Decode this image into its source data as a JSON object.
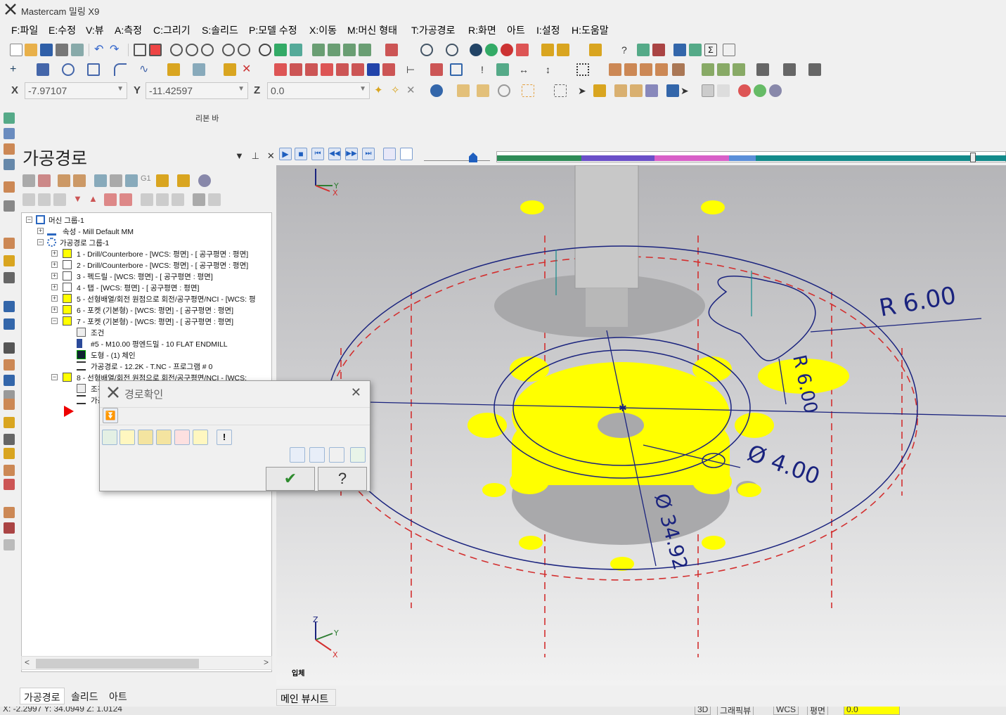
{
  "window": {
    "title": "Mastercam 밀링 X9"
  },
  "menu": [
    "F:파일",
    "E:수정",
    "V:뷰",
    "A:측정",
    "C:그리기",
    "S:솔리드",
    "P:모델 수정",
    "X:이동",
    "M:머신 형태",
    "T:가공경로",
    "R:화면",
    "아트",
    "I:설정",
    "H:도움말"
  ],
  "coords": {
    "x_label": "X",
    "x_value": "-7.97107",
    "y_label": "Y",
    "y_value": "-11.42597",
    "z_label": "Z",
    "z_value": "0.0"
  },
  "ribbon_label": "리본 바",
  "panel": {
    "title": "가공경로",
    "tree": [
      "머신 그룹-1",
      "속성 - Mill Default MM",
      "가공경로 그룹-1",
      "1 - Drill/Counterbore - [WCS: 평면] - [ 공구평면 : 평면]",
      "2 - Drill/Counterbore - [WCS: 평면] - [ 공구평면 : 평면]",
      "3 - 펙드릴 - [WCS: 평면] - [ 공구평면 : 평면]",
      "4 - 탭 - [WCS: 평면] - [ 공구평면 : 평면]",
      "5 - 선형배열/회전 원점으로 회전/공구평면/NCI - [WCS: 평",
      "6 - 포켓 (기본형) - [WCS: 평면] - [ 공구평면 : 평면]",
      "7 - 포켓 (기본형) - [WCS: 평면] - [ 공구평면 : 평면]",
      "조건",
      "#5 - M10.00 평엔드밀 - 10 FLAT ENDMILL",
      "도형 - (1) 체인",
      "가공경로 - 12.2K - T.NC - 프로그램 # 0",
      "8 - 선형배열/회전 원점으로 회전/공구평면/NCI - [WCS:",
      "조건",
      "가공경로"
    ],
    "tabs": [
      "가공경로",
      "솔리드",
      "아트"
    ]
  },
  "dialog": {
    "title": "경로확인"
  },
  "viewport": {
    "dims": {
      "r1": "R 6.00",
      "r2": "R 6.00",
      "dia1": "Ø 4.00",
      "dia2": "Ø 34.92"
    },
    "view_label": "입체",
    "axis": {
      "x": "X",
      "y": "Y",
      "z": "Z"
    }
  },
  "viewsheet_tab": "메인 뷰시트",
  "status": {
    "coords": "X: -2.2997   Y: 34.0949   Z: 1.0124",
    "mode": "3D",
    "gview": "그래픽뷰",
    "wcs": "WCS",
    "plane": "평면",
    "value": "0.0"
  },
  "colors": {
    "accent": "#1f5fbf",
    "part": "#ffff00",
    "toolpath": "#1a237e",
    "boundary": "#d32f2f"
  }
}
